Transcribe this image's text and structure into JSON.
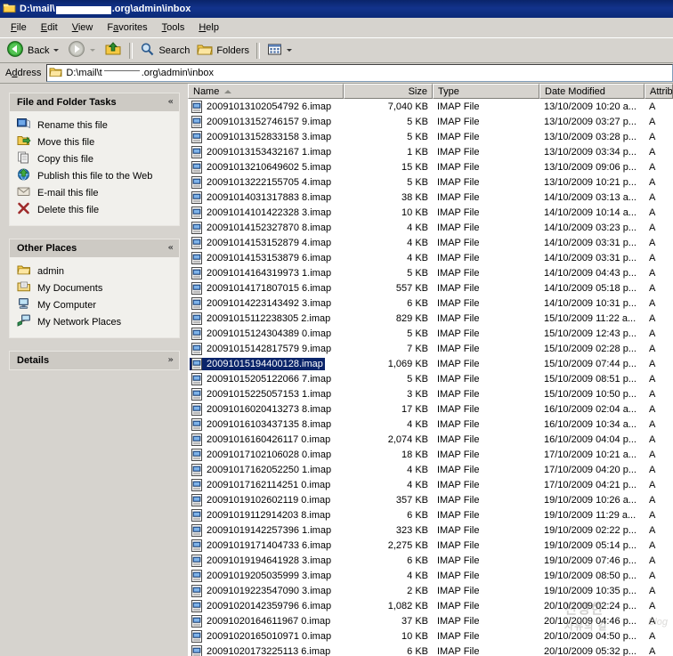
{
  "window": {
    "title_prefix": "D:\\mail\\",
    "title_suffix": ".org\\admin\\inbox",
    "title_redacted": true,
    "folder_icon": "folder-icon"
  },
  "menubar": {
    "items": [
      {
        "accel": "F",
        "rest": "ile",
        "name": "file"
      },
      {
        "accel": "E",
        "rest": "dit",
        "name": "edit"
      },
      {
        "accel": "V",
        "rest": "iew",
        "name": "view"
      },
      {
        "pre": "F",
        "accel": "a",
        "rest": "vorites",
        "name": "favorites"
      },
      {
        "pre": "",
        "accel": "T",
        "rest": "ools",
        "name": "tools"
      },
      {
        "accel": "H",
        "rest": "elp",
        "name": "help"
      }
    ]
  },
  "toolbar": {
    "back_label": "Back",
    "search_label": "Search",
    "folders_label": "Folders",
    "icons": {
      "back": "back-arrow-icon",
      "forward": "forward-arrow-icon",
      "up": "up-folder-icon",
      "search": "magnifier-icon",
      "folders": "folder-icon",
      "views": "views-icon"
    }
  },
  "address": {
    "label_pre": "A",
    "label_accel": "d",
    "label_post": "dress",
    "path_prefix": "D:\\mail\\t",
    "path_suffix": ".org\\admin\\inbox",
    "redacted": true
  },
  "taskpane": {
    "panels": [
      {
        "title": "File and Folder Tasks",
        "name": "file-and-folder-tasks",
        "collapse_glyph": "«",
        "collapsed": false,
        "items": [
          {
            "label": "Rename this file",
            "icon": "rename-icon",
            "name": "rename-this-file"
          },
          {
            "label": "Move this file",
            "icon": "move-icon",
            "name": "move-this-file"
          },
          {
            "label": "Copy this file",
            "icon": "copy-icon",
            "name": "copy-this-file"
          },
          {
            "label": "Publish this file to the Web",
            "icon": "publish-web-icon",
            "name": "publish-this-file-to-the-web"
          },
          {
            "label": "E-mail this file",
            "icon": "email-icon",
            "name": "email-this-file"
          },
          {
            "label": "Delete this file",
            "icon": "delete-x-icon",
            "name": "delete-this-file"
          }
        ]
      },
      {
        "title": "Other Places",
        "name": "other-places",
        "collapse_glyph": "«",
        "collapsed": false,
        "items": [
          {
            "label": "admin",
            "icon": "folder-icon",
            "name": "admin"
          },
          {
            "label": "My Documents",
            "icon": "my-documents-icon",
            "name": "my-documents"
          },
          {
            "label": "My Computer",
            "icon": "my-computer-icon",
            "name": "my-computer"
          },
          {
            "label": "My Network Places",
            "icon": "my-network-places-icon",
            "name": "my-network-places"
          }
        ]
      },
      {
        "title": "Details",
        "name": "details",
        "collapse_glyph": "»",
        "collapsed": true,
        "items": []
      }
    ]
  },
  "filelist": {
    "columns": [
      {
        "label": "Name",
        "width": 175,
        "align": "left",
        "sorted": "asc"
      },
      {
        "label": "Size",
        "width": 100,
        "align": "right",
        "sorted": null
      },
      {
        "label": "Type",
        "width": 120,
        "align": "left",
        "sorted": null
      },
      {
        "label": "Date Modified",
        "width": 118,
        "align": "left",
        "sorted": null
      },
      {
        "label": "Attrib",
        "width": 32,
        "align": "left",
        "sorted": null
      }
    ],
    "selected_index": 17,
    "file_icon": "imap-file-icon",
    "rows": [
      {
        "name": "20091013102054792 6.imap",
        "size": "7,040 KB",
        "type": "IMAP File",
        "date": "13/10/2009 10:20 a...",
        "attrib": "A"
      },
      {
        "name": "20091013152746157 9.imap",
        "size": "5 KB",
        "type": "IMAP File",
        "date": "13/10/2009 03:27 p...",
        "attrib": "A"
      },
      {
        "name": "20091013152833158 3.imap",
        "size": "5 KB",
        "type": "IMAP File",
        "date": "13/10/2009 03:28 p...",
        "attrib": "A"
      },
      {
        "name": "20091013153432167 1.imap",
        "size": "1 KB",
        "type": "IMAP File",
        "date": "13/10/2009 03:34 p...",
        "attrib": "A"
      },
      {
        "name": "20091013210649602 5.imap",
        "size": "15 KB",
        "type": "IMAP File",
        "date": "13/10/2009 09:06 p...",
        "attrib": "A"
      },
      {
        "name": "20091013222155705 4.imap",
        "size": "5 KB",
        "type": "IMAP File",
        "date": "13/10/2009 10:21 p...",
        "attrib": "A"
      },
      {
        "name": "20091014031317883 8.imap",
        "size": "38 KB",
        "type": "IMAP File",
        "date": "14/10/2009 03:13 a...",
        "attrib": "A"
      },
      {
        "name": "20091014101422328 3.imap",
        "size": "10 KB",
        "type": "IMAP File",
        "date": "14/10/2009 10:14 a...",
        "attrib": "A"
      },
      {
        "name": "20091014152327870 8.imap",
        "size": "4 KB",
        "type": "IMAP File",
        "date": "14/10/2009 03:23 p...",
        "attrib": "A"
      },
      {
        "name": "20091014153152879 4.imap",
        "size": "4 KB",
        "type": "IMAP File",
        "date": "14/10/2009 03:31 p...",
        "attrib": "A"
      },
      {
        "name": "20091014153153879 6.imap",
        "size": "4 KB",
        "type": "IMAP File",
        "date": "14/10/2009 03:31 p...",
        "attrib": "A"
      },
      {
        "name": "20091014164319973 1.imap",
        "size": "5 KB",
        "type": "IMAP File",
        "date": "14/10/2009 04:43 p...",
        "attrib": "A"
      },
      {
        "name": "20091014171807015 6.imap",
        "size": "557 KB",
        "type": "IMAP File",
        "date": "14/10/2009 05:18 p...",
        "attrib": "A"
      },
      {
        "name": "20091014223143492 3.imap",
        "size": "6 KB",
        "type": "IMAP File",
        "date": "14/10/2009 10:31 p...",
        "attrib": "A"
      },
      {
        "name": "20091015112238305 2.imap",
        "size": "829 KB",
        "type": "IMAP File",
        "date": "15/10/2009 11:22 a...",
        "attrib": "A"
      },
      {
        "name": "20091015124304389 0.imap",
        "size": "5 KB",
        "type": "IMAP File",
        "date": "15/10/2009 12:43 p...",
        "attrib": "A"
      },
      {
        "name": "20091015142817579 9.imap",
        "size": "7 KB",
        "type": "IMAP File",
        "date": "15/10/2009 02:28 p...",
        "attrib": "A"
      },
      {
        "name": "20091015194400128.imap",
        "size": "1,069 KB",
        "type": "IMAP File",
        "date": "15/10/2009 07:44 p...",
        "attrib": "A"
      },
      {
        "name": "20091015205122066 7.imap",
        "size": "5 KB",
        "type": "IMAP File",
        "date": "15/10/2009 08:51 p...",
        "attrib": "A"
      },
      {
        "name": "20091015225057153 1.imap",
        "size": "3 KB",
        "type": "IMAP File",
        "date": "15/10/2009 10:50 p...",
        "attrib": "A"
      },
      {
        "name": "20091016020413273 8.imap",
        "size": "17 KB",
        "type": "IMAP File",
        "date": "16/10/2009 02:04 a...",
        "attrib": "A"
      },
      {
        "name": "20091016103437135 8.imap",
        "size": "4 KB",
        "type": "IMAP File",
        "date": "16/10/2009 10:34 a...",
        "attrib": "A"
      },
      {
        "name": "20091016160426117 0.imap",
        "size": "2,074 KB",
        "type": "IMAP File",
        "date": "16/10/2009 04:04 p...",
        "attrib": "A"
      },
      {
        "name": "20091017102106028 0.imap",
        "size": "18 KB",
        "type": "IMAP File",
        "date": "17/10/2009 10:21 a...",
        "attrib": "A"
      },
      {
        "name": "20091017162052250 1.imap",
        "size": "4 KB",
        "type": "IMAP File",
        "date": "17/10/2009 04:20 p...",
        "attrib": "A"
      },
      {
        "name": "20091017162114251 0.imap",
        "size": "4 KB",
        "type": "IMAP File",
        "date": "17/10/2009 04:21 p...",
        "attrib": "A"
      },
      {
        "name": "20091019102602119 0.imap",
        "size": "357 KB",
        "type": "IMAP File",
        "date": "19/10/2009 10:26 a...",
        "attrib": "A"
      },
      {
        "name": "20091019112914203 8.imap",
        "size": "6 KB",
        "type": "IMAP File",
        "date": "19/10/2009 11:29 a...",
        "attrib": "A"
      },
      {
        "name": "20091019142257396 1.imap",
        "size": "323 KB",
        "type": "IMAP File",
        "date": "19/10/2009 02:22 p...",
        "attrib": "A"
      },
      {
        "name": "20091019171404733 6.imap",
        "size": "2,275 KB",
        "type": "IMAP File",
        "date": "19/10/2009 05:14 p...",
        "attrib": "A"
      },
      {
        "name": "20091019194641928 3.imap",
        "size": "6 KB",
        "type": "IMAP File",
        "date": "19/10/2009 07:46 p...",
        "attrib": "A"
      },
      {
        "name": "20091019205035999 3.imap",
        "size": "4 KB",
        "type": "IMAP File",
        "date": "19/10/2009 08:50 p...",
        "attrib": "A"
      },
      {
        "name": "20091019223547090 3.imap",
        "size": "2 KB",
        "type": "IMAP File",
        "date": "19/10/2009 10:35 p...",
        "attrib": "A"
      },
      {
        "name": "20091020142359796 6.imap",
        "size": "1,082 KB",
        "type": "IMAP File",
        "date": "20/10/2009 02:24 p...",
        "attrib": "A"
      },
      {
        "name": "20091020164611967 0.imap",
        "size": "37 KB",
        "type": "IMAP File",
        "date": "20/10/2009 04:46 p...",
        "attrib": "A"
      },
      {
        "name": "20091020165010971 0.imap",
        "size": "10 KB",
        "type": "IMAP File",
        "date": "20/10/2009 04:50 p...",
        "attrib": "A"
      },
      {
        "name": "20091020173225113 6.imap",
        "size": "6 KB",
        "type": "IMAP File",
        "date": "20/10/2009 05:32 p...",
        "attrib": "A"
      }
    ]
  },
  "watermark": {
    "line1": "진정한",
    "line2": "자유의 길",
    "blog": "Blog"
  }
}
